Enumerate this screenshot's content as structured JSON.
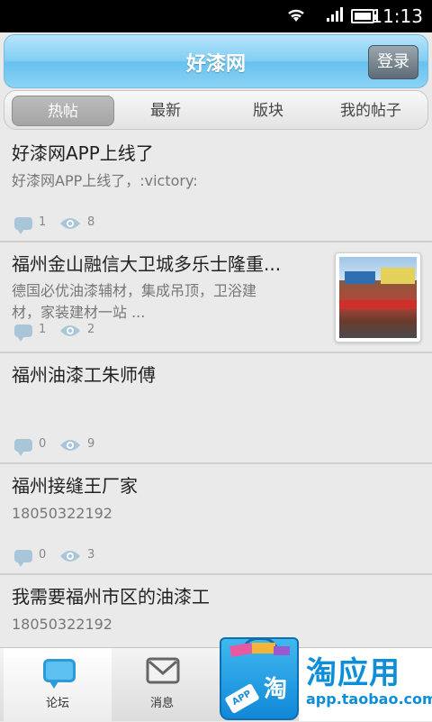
{
  "status_bar": {
    "time": "11:13",
    "network": "3G\n1x"
  },
  "header": {
    "title": "好漆网",
    "login_label": "登录"
  },
  "tabs": [
    {
      "label": "热帖",
      "active": true
    },
    {
      "label": "最新",
      "active": false
    },
    {
      "label": "版块",
      "active": false
    },
    {
      "label": "我的帖子",
      "active": false
    }
  ],
  "posts": [
    {
      "title": "好漆网APP上线了",
      "subtitle": "好漆网APP上线了，:victory:",
      "comments": "1",
      "views": "8",
      "has_thumb": false
    },
    {
      "title": "福州金山融信大卫城多乐士隆重...",
      "subtitle_line1": "德国必优油漆辅材，集成吊顶，卫浴建",
      "subtitle_line2": "材，家装建材一站 ...",
      "comments": "1",
      "views": "2",
      "has_thumb": true
    },
    {
      "title": "福州油漆工朱师傅",
      "subtitle": "",
      "comments": "0",
      "views": "9",
      "has_thumb": false
    },
    {
      "title": "福州接缝王厂家",
      "subtitle": "18050322192",
      "comments": "0",
      "views": "3",
      "has_thumb": false
    },
    {
      "title": "我需要福州市区的油漆工",
      "subtitle": "18050322192",
      "comments": "",
      "views": "",
      "has_thumb": false
    }
  ],
  "bottom_nav": [
    {
      "label": "论坛",
      "icon": "forum-icon",
      "active": true
    },
    {
      "label": "消息",
      "icon": "message-icon",
      "active": false
    }
  ],
  "ad": {
    "text": "淘应用",
    "url": "app.taobao.com",
    "bag_char": "淘",
    "bag_tag": "APP"
  },
  "colors": {
    "header_blue": "#7fcdf3",
    "accent_blue": "#0d8ed9",
    "tab_active": "#a4a4a4"
  }
}
